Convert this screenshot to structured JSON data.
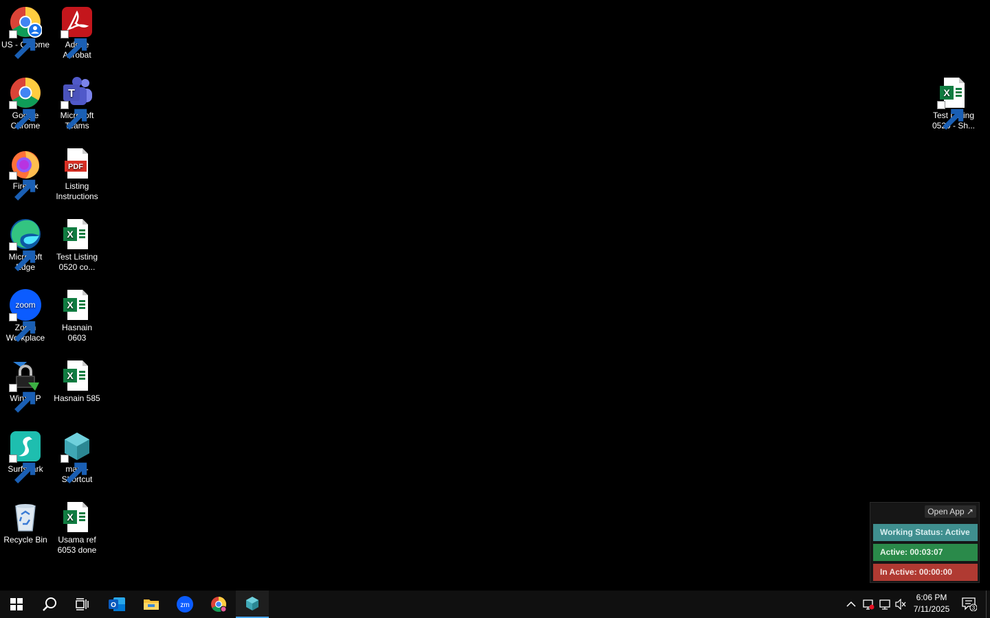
{
  "desktop": {
    "icons": [
      {
        "name": "US - Chrome",
        "icon": "chrome-profile-icon"
      },
      {
        "name": "Adobe Acrobat",
        "icon": "acrobat-icon"
      },
      {
        "name": "Google Chrome",
        "icon": "chrome-icon"
      },
      {
        "name": "Microsoft Teams",
        "icon": "teams-icon"
      },
      {
        "name": "Firefox",
        "icon": "firefox-icon"
      },
      {
        "name": "Listing Instructions",
        "icon": "pdf-icon"
      },
      {
        "name": "Microsoft Edge",
        "icon": "edge-icon"
      },
      {
        "name": "Test Listing 0520 co...",
        "icon": "excel-icon"
      },
      {
        "name": "Zoom Workplace",
        "icon": "zoom-icon"
      },
      {
        "name": "Hasnain 0603",
        "icon": "excel-icon"
      },
      {
        "name": "WinSCP",
        "icon": "winscp-icon"
      },
      {
        "name": "Hasnain 585",
        "icon": "excel-icon"
      },
      {
        "name": "Surfshark",
        "icon": "surfshark-icon"
      },
      {
        "name": "main - Shortcut",
        "icon": "app-diamond-icon"
      },
      {
        "name": "Recycle Bin",
        "icon": "recycle-bin-icon"
      },
      {
        "name": "Usama ref 6053 done",
        "icon": "excel-icon"
      },
      {
        "name": "Test Listing 0520 - Sh...",
        "icon": "excel-icon"
      }
    ],
    "zoom_logo_text": "zoom",
    "pdf_badge_text": "PDF",
    "excel_letter": "X",
    "teams_letter": "T"
  },
  "tracker": {
    "open_app_label": "Open App ↗",
    "working_status": "Working Status: Active",
    "active_time": "Active: 00:03:07",
    "inactive_time": "In Active: 00:00:00",
    "colors": {
      "working": "#3f8f8f",
      "active": "#2a8a4a",
      "inactive": "#b03a32"
    }
  },
  "taskbar": {
    "apps": [
      "start-icon",
      "search-icon",
      "task-view-icon",
      "outlook-icon",
      "file-explorer-icon",
      "zoom-icon",
      "chrome-icon",
      "app-diamond-icon"
    ],
    "zoom_text": "zm",
    "outlook_letter": "O",
    "clock_time": "6:06 PM",
    "clock_date": "7/11/2025",
    "notification_count": "3"
  }
}
